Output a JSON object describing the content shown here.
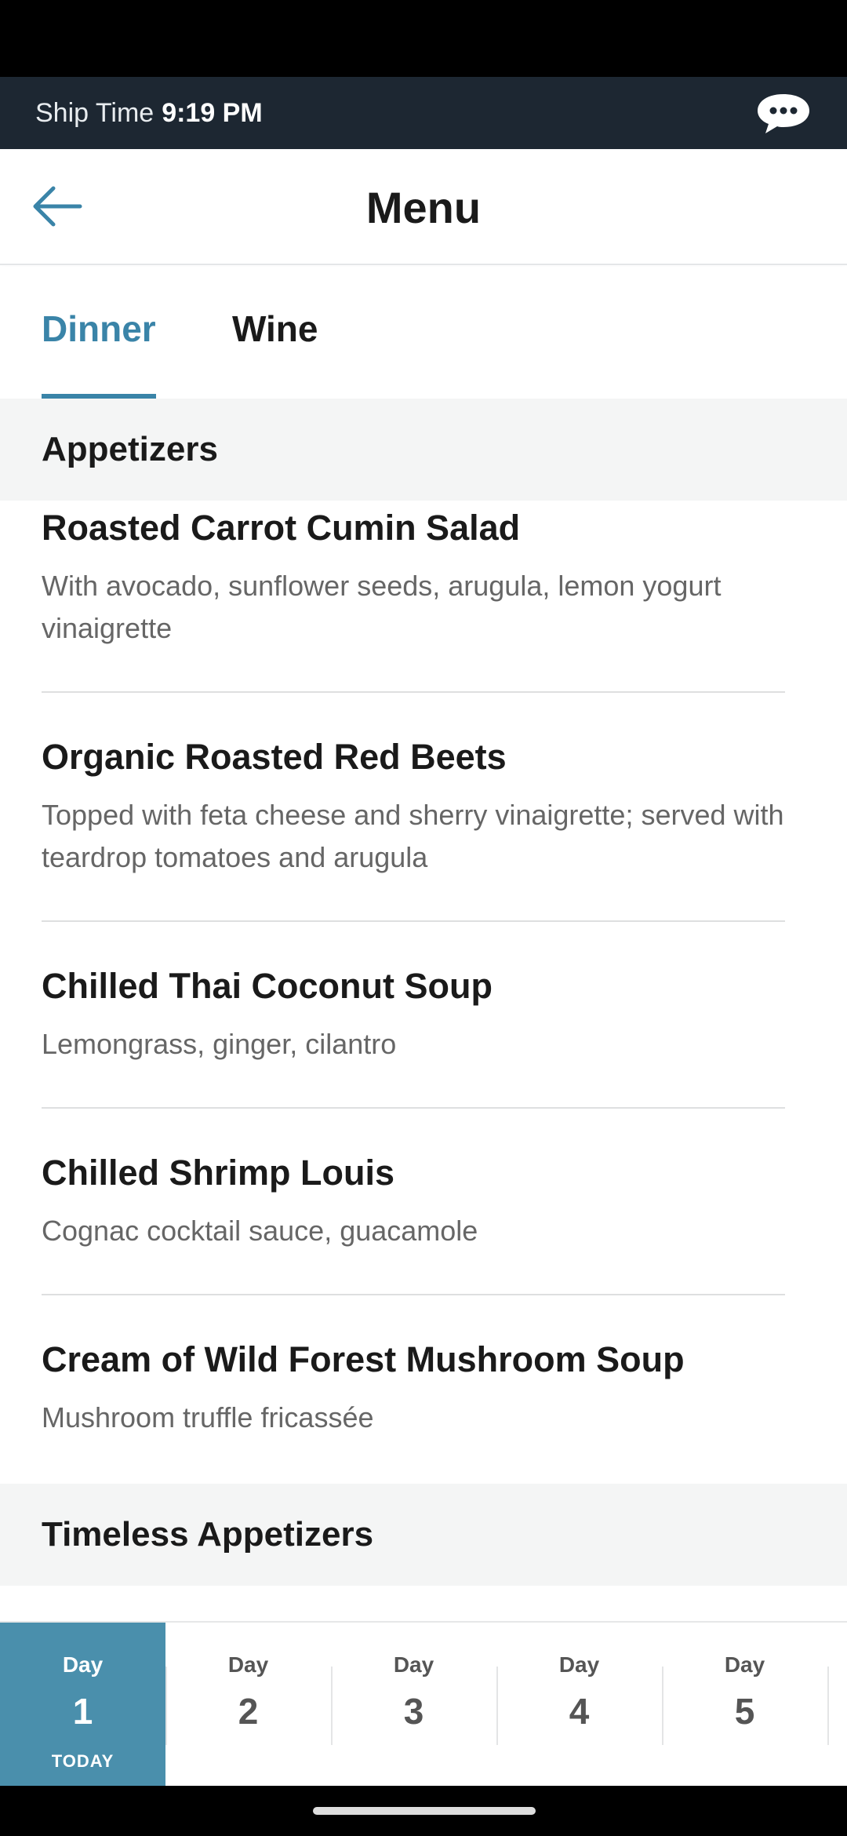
{
  "ship": {
    "label": "Ship Time",
    "time": "9:19 PM"
  },
  "header": {
    "title": "Menu"
  },
  "tabs": [
    {
      "label": "Dinner",
      "active": true
    },
    {
      "label": "Wine",
      "active": false
    }
  ],
  "sections": {
    "appetizers": "Appetizers",
    "timeless": "Timeless Appetizers"
  },
  "items": [
    {
      "name": "Roasted Carrot Cumin Salad",
      "desc": "With avocado, sunflower seeds, arugula, lemon yogurt vinaigrette"
    },
    {
      "name": "Organic Roasted Red Beets",
      "desc": "Topped with feta cheese and sherry vinaigrette; served with teardrop tomatoes and arugula"
    },
    {
      "name": "Chilled Thai Coconut Soup",
      "desc": "Lemongrass, ginger, cilantro"
    },
    {
      "name": "Chilled Shrimp Louis",
      "desc": "Cognac cocktail sauce, guacamole"
    },
    {
      "name": "Cream of Wild Forest Mushroom Soup",
      "desc": "Mushroom truffle fricassée"
    }
  ],
  "days": [
    {
      "label": "Day",
      "num": "1",
      "sub": "TODAY",
      "active": true
    },
    {
      "label": "Day",
      "num": "2"
    },
    {
      "label": "Day",
      "num": "3"
    },
    {
      "label": "Day",
      "num": "4"
    },
    {
      "label": "Day",
      "num": "5"
    }
  ],
  "icons": {
    "back": "back-arrow-icon",
    "chat": "chat-bubble-icon"
  },
  "colors": {
    "accent": "#3a84a8",
    "day_active_bg": "#4a8fac",
    "ship_bar_bg": "#1d2732"
  }
}
